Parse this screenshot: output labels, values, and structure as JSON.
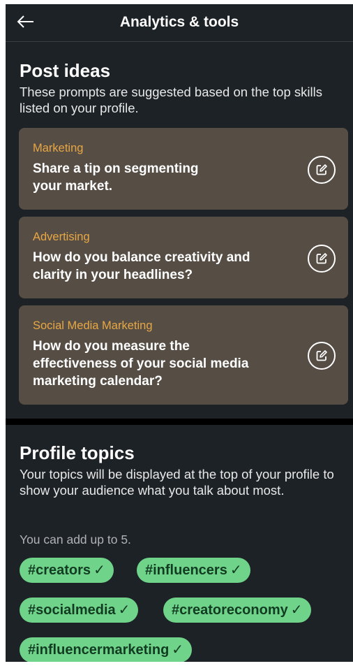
{
  "header": {
    "title": "Analytics & tools"
  },
  "post_ideas": {
    "title": "Post ideas",
    "description": "These prompts are suggested based on the top skills listed on your profile.",
    "cards": [
      {
        "category": "Marketing",
        "prompt": "Share a tip on segmenting your market."
      },
      {
        "category": "Advertising",
        "prompt": "How do you balance creativity and clarity in your headlines?"
      },
      {
        "category": "Social Media Marketing",
        "prompt": "How do you measure the effectiveness of your social media marketing calendar?"
      }
    ]
  },
  "profile_topics": {
    "title": "Profile topics",
    "description": "Your topics will be displayed at the top of your profile to show your audience what you talk about most.",
    "limit_hint": "You can add up to 5.",
    "topics": [
      "#creators",
      "#influencers",
      "#socialmedia",
      "#creatoreconomy",
      "#influencermarketing"
    ],
    "check_glyph": "✓"
  },
  "colors": {
    "background": "#1d2226",
    "card": "#564e45",
    "category": "#e8a745",
    "chip": "#70d38a",
    "chip_text": "#123c22"
  }
}
